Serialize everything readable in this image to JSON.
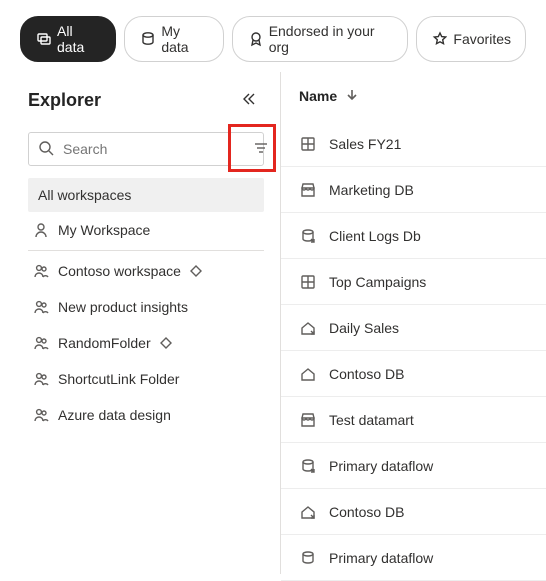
{
  "filters": {
    "all_data": "All data",
    "my_data": "My data",
    "endorsed": "Endorsed in your org",
    "favorites": "Favorites"
  },
  "explorer": {
    "title": "Explorer",
    "search_placeholder": "Search",
    "all_workspaces": "All workspaces",
    "workspaces": [
      {
        "label": "My Workspace",
        "icon": "person",
        "premium": false
      },
      {
        "label": "Contoso workspace",
        "icon": "people",
        "premium": true
      },
      {
        "label": "New product insights",
        "icon": "people",
        "premium": false
      },
      {
        "label": "RandomFolder",
        "icon": "people",
        "premium": true
      },
      {
        "label": "ShortcutLink Folder",
        "icon": "people",
        "premium": false
      },
      {
        "label": "Azure data design",
        "icon": "people",
        "premium": false
      }
    ]
  },
  "list": {
    "header": "Name",
    "sort": "asc",
    "items": [
      {
        "label": "Sales FY21",
        "icon": "grid"
      },
      {
        "label": "Marketing DB",
        "icon": "store"
      },
      {
        "label": "Client Logs Db",
        "icon": "db-arrow"
      },
      {
        "label": "Top Campaigns",
        "icon": "grid"
      },
      {
        "label": "Daily Sales",
        "icon": "house-arrow"
      },
      {
        "label": "Contoso DB",
        "icon": "house"
      },
      {
        "label": "Test datamart",
        "icon": "store"
      },
      {
        "label": "Primary dataflow",
        "icon": "db-arrow"
      },
      {
        "label": "Contoso DB",
        "icon": "house-arrow"
      },
      {
        "label": "Primary dataflow",
        "icon": "db"
      }
    ]
  }
}
